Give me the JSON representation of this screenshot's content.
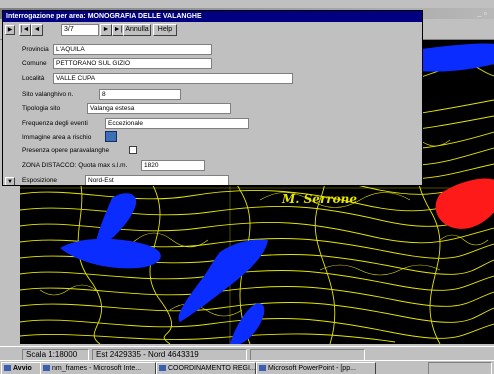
{
  "dialog": {
    "title": "Interrogazione per area: MONOGRAFIA DELLE VALANGHE",
    "nav": {
      "first": "|◄",
      "prev": "◄",
      "record": "3/7",
      "next": "►",
      "last": "►|",
      "annulla": "Annulla",
      "help": "Help"
    },
    "fields": {
      "provincia": {
        "label": "Provincia",
        "value": "L'AQUILA"
      },
      "comune": {
        "label": "Comune",
        "value": "PETTORANO SUL GIZIO"
      },
      "localita": {
        "label": "Località",
        "value": "VALLE CUPA"
      },
      "sito": {
        "label": "Sito valanghivo n.",
        "value": "8"
      },
      "tipologia": {
        "label": "Tipologia sito",
        "value": "Valanga estesa"
      },
      "frequenza": {
        "label": "Frequenza degli eventi",
        "value": "Eccezionale"
      },
      "immagine": {
        "label": "Immagine area a rischio"
      },
      "presenza": {
        "label": "Presenza opere paravalanghe"
      },
      "zona": {
        "label": "ZONA DISTACCO: Quota max s.l.m.",
        "value": "1820"
      },
      "esposizione": {
        "label": "Esposizione",
        "value": "Nord-Est"
      }
    }
  },
  "map": {
    "place_label": "M. Serrone",
    "colors": {
      "terrain": "#e6e600",
      "avalanche_zone": "#0a2cff",
      "risk_zone": "#ff1a1a",
      "background": "#000000"
    }
  },
  "statusbar": {
    "scale": "Scala 1:18000",
    "coords": "Est 2429335 - Nord 4643319"
  },
  "taskbar": {
    "start": "Avvio",
    "items": [
      "nm_frames - Microsoft Inte...",
      "COORDINAMENTO REGI...",
      "Microsoft PowerPoint - [pp..."
    ]
  },
  "bg_window": {
    "controls": "_ ▫ x"
  }
}
